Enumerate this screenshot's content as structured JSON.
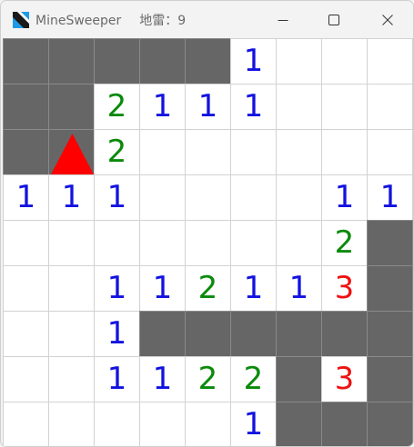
{
  "window": {
    "title": "MineSweeper",
    "mine_label": "地雷：",
    "mine_count": "9"
  },
  "colors": {
    "covered": "#666666",
    "grid_line": "#d2d2d2",
    "flag": "#ff0000",
    "num_1": "#1212e0",
    "num_2": "#0a8a0a",
    "num_3": "#ee1111"
  },
  "board": {
    "rows": 9,
    "cols": 9,
    "cells": [
      [
        "#",
        "#",
        "#",
        "#",
        "#",
        "1",
        "",
        "",
        ""
      ],
      [
        "#",
        "#",
        "2",
        "1",
        "1",
        "1",
        "",
        "",
        ""
      ],
      [
        "#",
        "F",
        "2",
        "",
        "",
        "",
        "",
        "",
        ""
      ],
      [
        "1",
        "1",
        "1",
        "",
        "",
        "",
        "",
        "1",
        "1"
      ],
      [
        "",
        "",
        "",
        "",
        "",
        "",
        "",
        "2",
        "#"
      ],
      [
        "",
        "",
        "1",
        "1",
        "2",
        "1",
        "1",
        "3",
        "#"
      ],
      [
        "",
        "",
        "1",
        "#",
        "#",
        "#",
        "#",
        "#",
        "#"
      ],
      [
        "",
        "",
        "1",
        "1",
        "2",
        "2",
        "#",
        "3",
        "#"
      ],
      [
        "",
        "",
        "",
        "",
        "",
        "1",
        "#",
        "#",
        "#"
      ]
    ]
  }
}
